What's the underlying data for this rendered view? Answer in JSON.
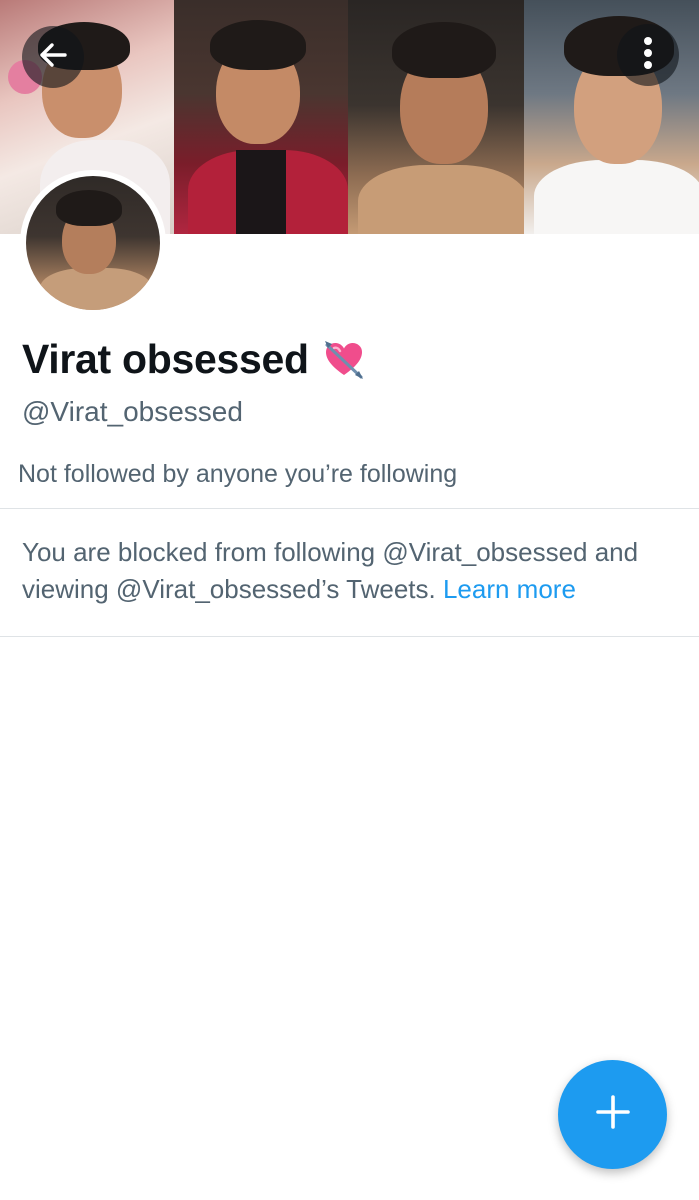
{
  "profile": {
    "display_name": "Virat obsessed",
    "name_emoji": "heart-with-arrow-icon",
    "handle": "@Virat_obsessed",
    "followed_note": "Not followed by anyone you’re following"
  },
  "blocked": {
    "message": "You are blocked from following @Virat_obsessed and viewing @Virat_obsessed’s Tweets.",
    "learn_more": "Learn more"
  },
  "icons": {
    "back": "back-arrow-icon",
    "more": "more-vertical-icon",
    "compose": "plus-icon"
  },
  "colors": {
    "accent": "#1d9bf0",
    "primary_text": "#0f1419",
    "secondary_text": "#536471",
    "divider": "#dfe3e6"
  }
}
